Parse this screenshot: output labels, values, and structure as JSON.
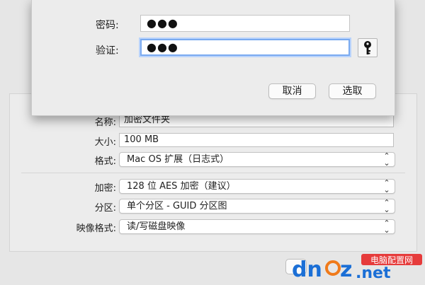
{
  "sheet": {
    "password_label": "密码:",
    "password_value": "●●●",
    "verify_label": "验证:",
    "verify_value": "●●●",
    "cancel_label": "取消",
    "choose_label": "选取",
    "key_icon": "key-icon"
  },
  "dialog": {
    "name_label": "名称:",
    "name_value": "加密文件夹",
    "size_label": "大小:",
    "size_value": "100 MB",
    "format_label": "格式:",
    "format_value": "Mac OS 扩展（日志式）",
    "encryption_label": "加密:",
    "encryption_value": "128 位 AES 加密（建议）",
    "partition_label": "分区:",
    "partition_value": "单个分区 - GUID 分区图",
    "image_format_label": "映像格式:",
    "image_format_value": "读/写磁盘映像"
  },
  "watermark": {
    "brand": "dnpz.net",
    "tag": "电脑配置网"
  },
  "colors": {
    "focus_ring": "#7aaaf0",
    "watermark_blue": "#1b6fd6",
    "watermark_orange": "#f07a1a",
    "watermark_red": "#e63b3b"
  }
}
